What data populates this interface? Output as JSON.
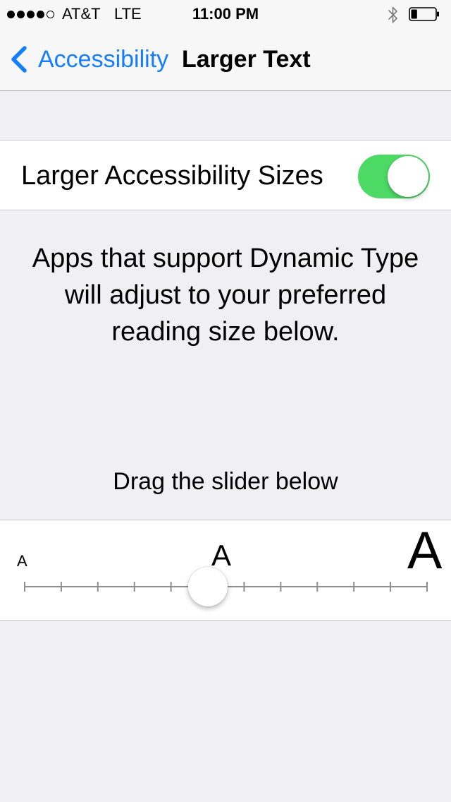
{
  "status_bar": {
    "signal_bars_filled": 4,
    "signal_bars_total": 5,
    "carrier": "AT&T",
    "network": "LTE",
    "time": "11:00 PM",
    "bluetooth_icon": "bluetooth-icon",
    "battery_icon": "battery-icon",
    "battery_level": 0.25
  },
  "nav": {
    "back_label": "Accessibility",
    "back_icon": "chevron-left-icon",
    "title": "Larger Text",
    "accent_color": "#147efb"
  },
  "toggle": {
    "label": "Larger Accessibility Sizes",
    "on": true,
    "on_color": "#4cd964"
  },
  "description": "Apps that support Dynamic Type will adjust to your preferred reading size below.",
  "hint": "Drag the slider below",
  "slider": {
    "small_label": "A",
    "medium_label": "A",
    "large_label": "A",
    "steps": 12,
    "selected_index": 5
  }
}
